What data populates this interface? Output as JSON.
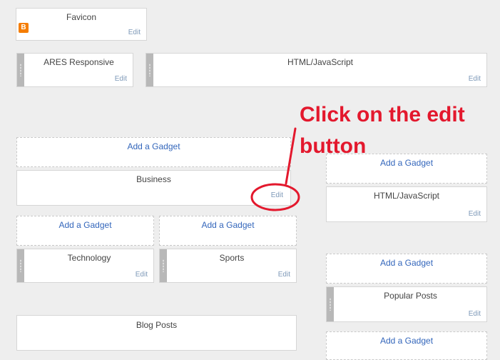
{
  "favicon": {
    "title": "Favicon",
    "edit": "Edit",
    "icon": "blogger-icon"
  },
  "header": {
    "ares": {
      "title": "ARES Responsive",
      "edit": "Edit"
    },
    "html1": {
      "title": "HTML/JavaScript",
      "edit": "Edit"
    }
  },
  "main": {
    "add1": "Add a Gadget",
    "business": {
      "title": "Business",
      "edit": "Edit"
    },
    "add2": "Add a Gadget",
    "add3": "Add a Gadget",
    "technology": {
      "title": "Technology",
      "edit": "Edit"
    },
    "sports": {
      "title": "Sports",
      "edit": "Edit"
    },
    "blogposts": {
      "title": "Blog Posts"
    }
  },
  "sidebar": {
    "add1": "Add a Gadget",
    "html2": {
      "title": "HTML/JavaScript",
      "edit": "Edit"
    },
    "add2": "Add a Gadget",
    "popular": {
      "title": "Popular Posts",
      "edit": "Edit"
    },
    "add3": "Add a Gadget"
  },
  "annotation": {
    "line1": "Click on the edit",
    "line2": "button",
    "color": "#e3182d"
  }
}
